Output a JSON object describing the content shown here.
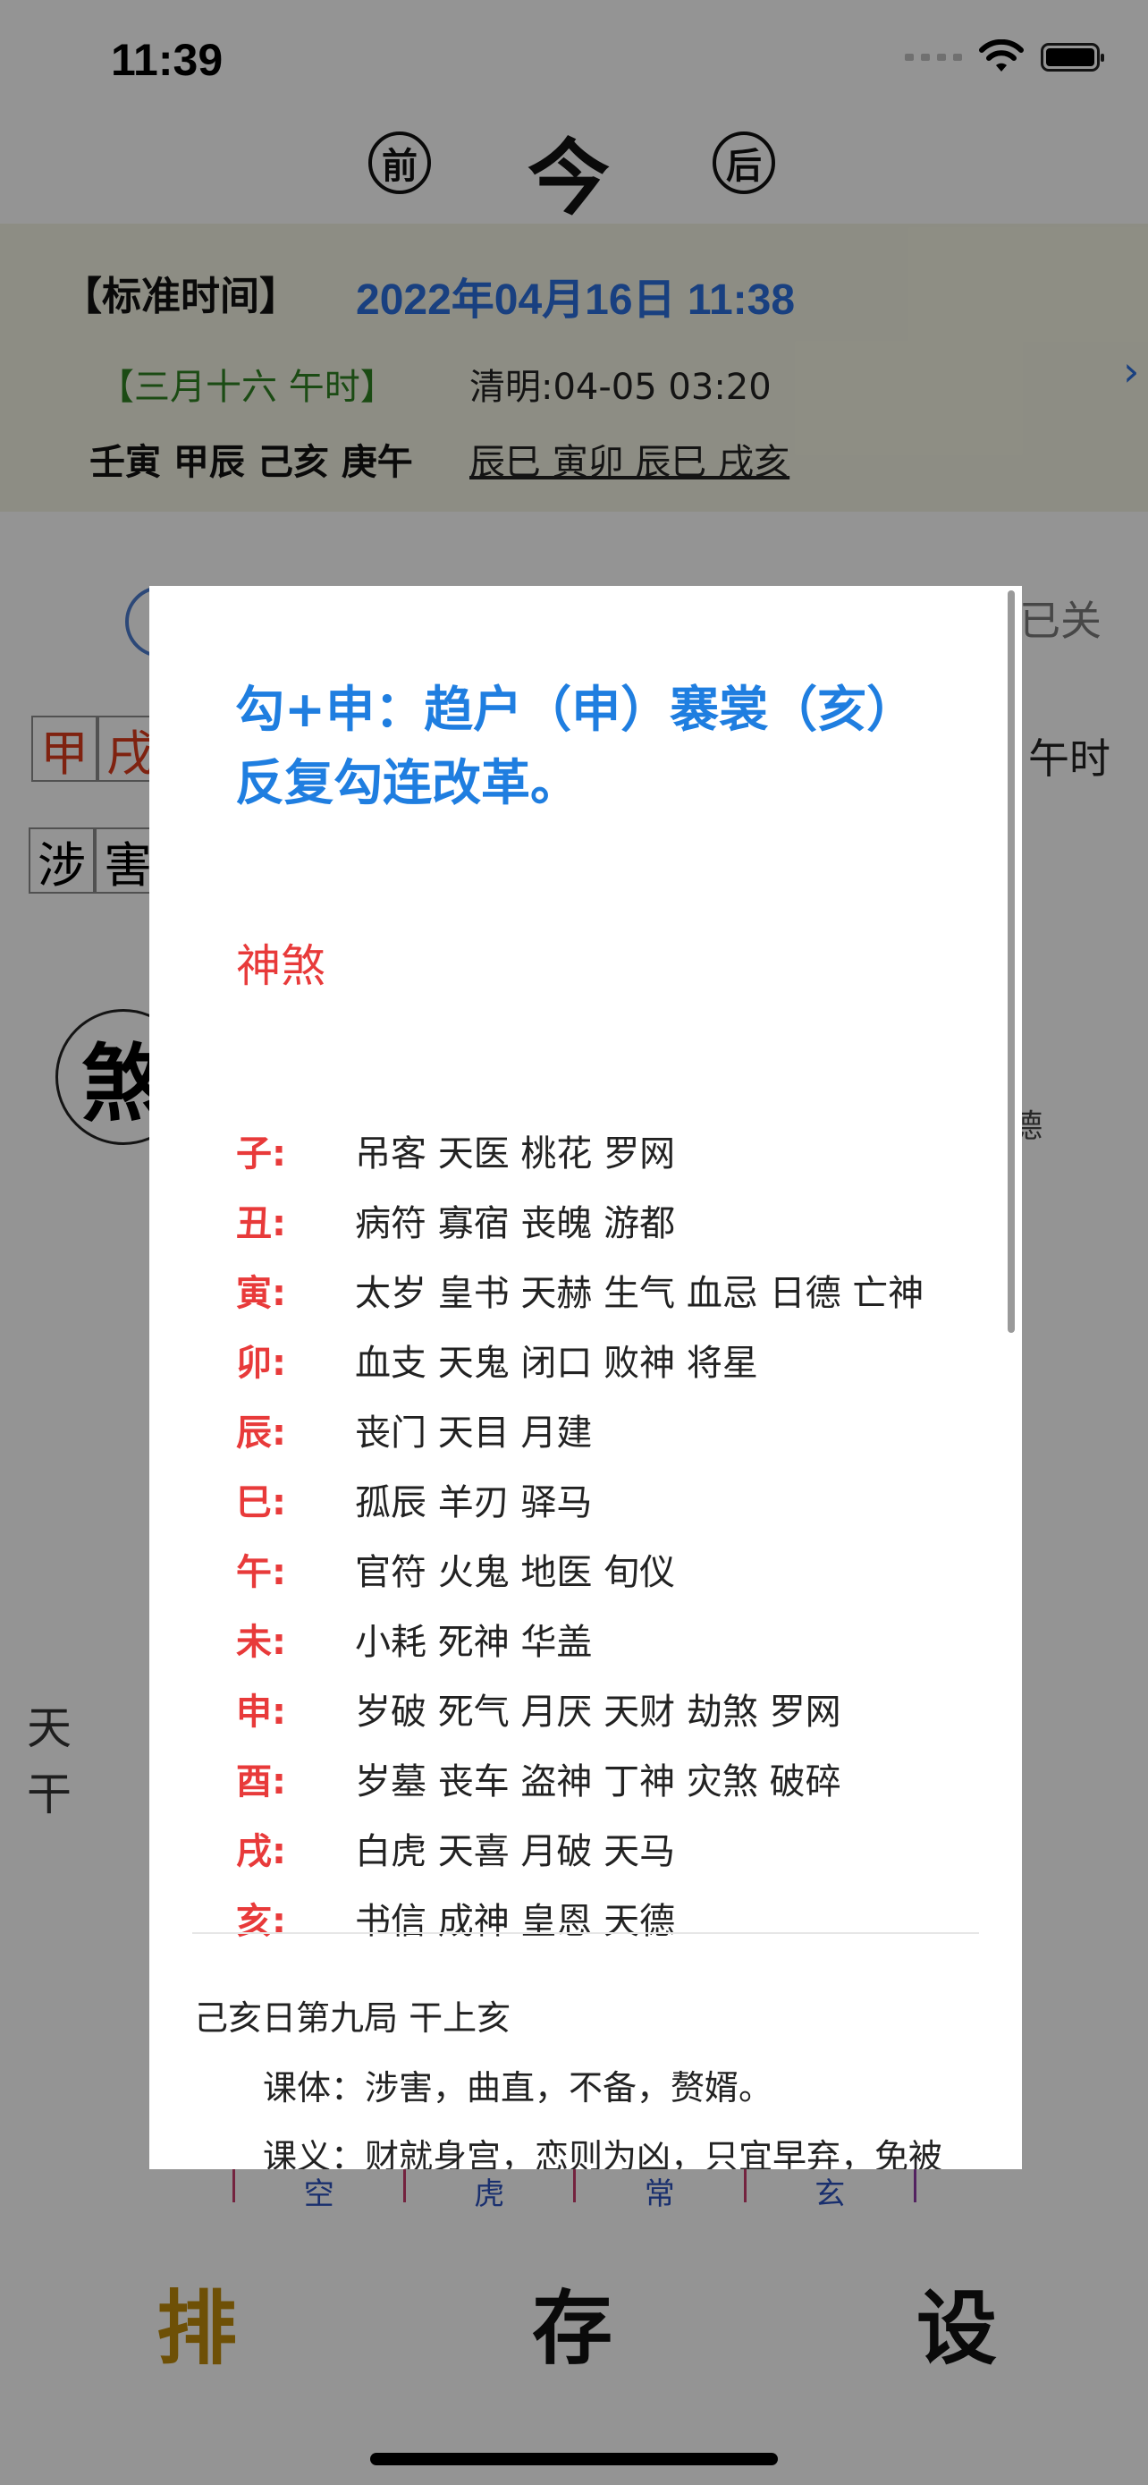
{
  "status_bar": {
    "time": "11:39"
  },
  "nav": {
    "prev": "前",
    "current": "今",
    "next": "后"
  },
  "info": {
    "std_label": "【标准时间】",
    "std_value": "2022年04月16日 11:38",
    "lunar": "【三月十六  午时】",
    "solar_term": "清明:04-05 03:20",
    "pillars": "壬寅 甲辰 己亥 庚午",
    "branches": "辰巳 寅卯 辰巳 戌亥"
  },
  "background": {
    "closed_label": "已关",
    "cells_row1": [
      "甲",
      "戌"
    ],
    "cells_row2": [
      "涉",
      "害"
    ],
    "noon": "午时",
    "seal": "煞",
    "de": "德",
    "vertical": [
      "天",
      "干"
    ],
    "strip": [
      "空",
      "虎",
      "常",
      "玄"
    ]
  },
  "modal": {
    "title": "勾+申：趋户（申）褰裳（亥）反复勾连改革。",
    "shensha_heading": "神煞",
    "shensha": [
      {
        "key": "子:",
        "value": "吊客 天医 桃花 罗网"
      },
      {
        "key": "丑:",
        "value": "病符 寡宿 丧魄 游都"
      },
      {
        "key": "寅:",
        "value": "太岁 皇书 天赫 生气 血忌 日德 亡神"
      },
      {
        "key": "卯:",
        "value": "血支 天鬼 闭口 败神 将星"
      },
      {
        "key": "辰:",
        "value": "丧门 天目 月建"
      },
      {
        "key": "巳:",
        "value": "孤辰 羊刃 驿马"
      },
      {
        "key": "午:",
        "value": "官符 火鬼 地医 旬仪"
      },
      {
        "key": "未:",
        "value": "小耗 死神 华盖"
      },
      {
        "key": "申:",
        "value": "岁破 死气 月厌 天财 劫煞 罗网"
      },
      {
        "key": "酉:",
        "value": "岁墓 丧车 盗神 丁神 灾煞 破碎"
      },
      {
        "key": "戌:",
        "value": "白虎 天喜 月破 天马"
      },
      {
        "key": "亥:",
        "value": "书信 成神 皇恩 天德"
      }
    ],
    "day_line": "己亥日第九局    干上亥",
    "keti": "课体：涉害，曲直，不备，赘婿。",
    "keyi": "课义：财就身宫，恋则为凶，只宜早弃，免被"
  },
  "tabbar": {
    "pai": "排",
    "cun": "存",
    "she": "设"
  },
  "colors": {
    "accent_blue": "#1f7ee0",
    "red": "#e83a3a",
    "green": "#2e7d22",
    "gold": "#b8860b"
  }
}
